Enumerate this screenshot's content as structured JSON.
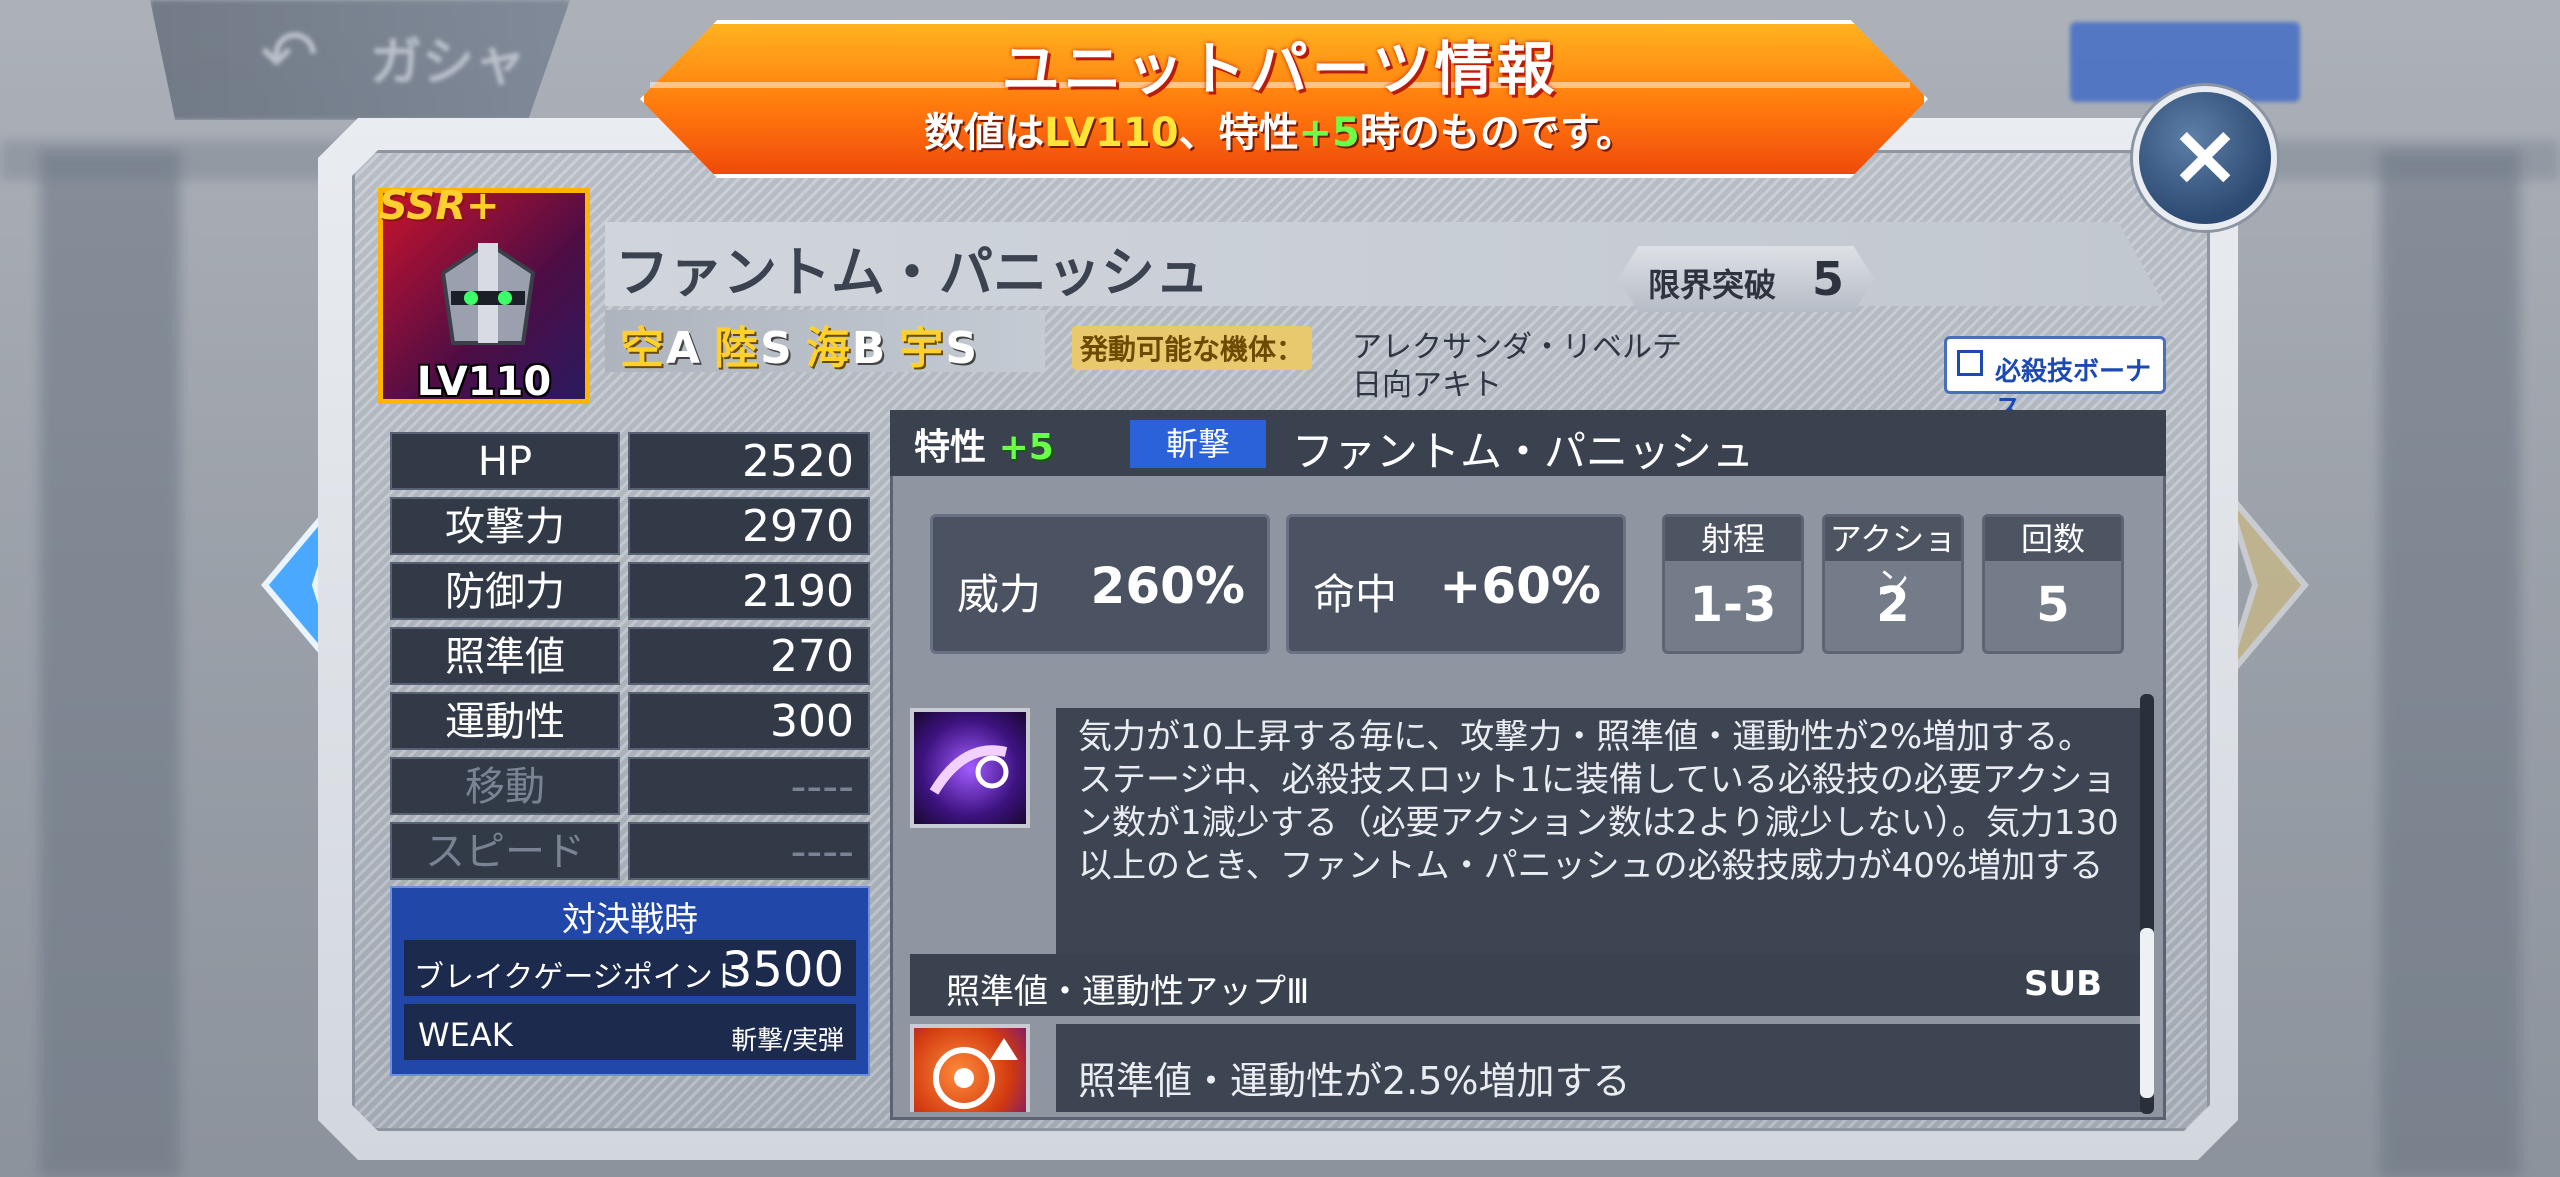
{
  "background": {
    "back_label": "ガシャ"
  },
  "banner": {
    "title": "ユニットパーツ情報",
    "sub_prefix": "数値は",
    "sub_level": "LV110",
    "sub_mid": "、特性",
    "sub_trait": "+5",
    "sub_suffix": "時のものです。"
  },
  "close_button": "×",
  "unit": {
    "rarity": "SSR+",
    "level": "LV110",
    "name": "ファントム・パニッシュ",
    "limit_break_label": "限界突破",
    "limit_break_value": "5",
    "terrain": [
      {
        "k": "空",
        "v": "A"
      },
      {
        "k": "陸",
        "v": "S"
      },
      {
        "k": "海",
        "v": "B"
      },
      {
        "k": "宇",
        "v": "S"
      }
    ],
    "pilot_label": "発動可能な機体：",
    "pilots": [
      "アレクサンダ・リベルテ",
      "日向アキト"
    ],
    "bonus_button": "必殺技ボーナス"
  },
  "stats": [
    {
      "label": "HP",
      "value": "2520"
    },
    {
      "label": "攻撃力",
      "value": "2970"
    },
    {
      "label": "防御力",
      "value": "2190"
    },
    {
      "label": "照準値",
      "value": "270"
    },
    {
      "label": "運動性",
      "value": "300"
    },
    {
      "label": "移動",
      "value": "----"
    },
    {
      "label": "スピード",
      "value": "----"
    }
  ],
  "battle": {
    "title": "対決戦時",
    "break_label": "ブレイクゲージポイント",
    "break_value": "3500",
    "weak_label": "WEAK",
    "weak_value": "斬撃/実弾"
  },
  "skill": {
    "trait_label": "特性",
    "trait_value": "+5",
    "type_tag": "斬撃",
    "name": "ファントム・パニッシュ",
    "power_label": "威力",
    "power_value": "260%",
    "hit_label": "命中",
    "hit_value": "+60%",
    "range_label": "射程",
    "range_value": "1-3",
    "action_label": "アクション",
    "action_value": "2",
    "count_label": "回数",
    "count_value": "5"
  },
  "abilities": {
    "ability1_text": "気力が10上昇する毎に、攻撃力・照準値・運動性が2%増加する。ステージ中、必殺技スロット1に装備している必殺技の必要アクション数が1減少する（必要アクション数は2より減少しない）。気力130以上のとき、ファントム・パニッシュの必殺技威力が40%増加する",
    "sub_title": "照準値・運動性アップⅢ",
    "sub_tag": "SUB",
    "ability2_text": "照準値・運動性が2.5%増加する"
  },
  "colors": {
    "banner_orange": "#ff7a0d",
    "rarity_gold": "#ffb400",
    "trait_green": "#6bff4a",
    "slash_blue": "#2b62d9",
    "battle_blue": "#2147a8",
    "close_navy": "#2d4a72"
  },
  "icons": {
    "back": "back-arrow-icon",
    "close": "close-icon",
    "nav_left": "chevron-left-icon",
    "nav_right": "chevron-right-icon",
    "bonus": "copy-icon",
    "ability1": "slash-skill-icon",
    "ability2": "target-up-icon"
  }
}
